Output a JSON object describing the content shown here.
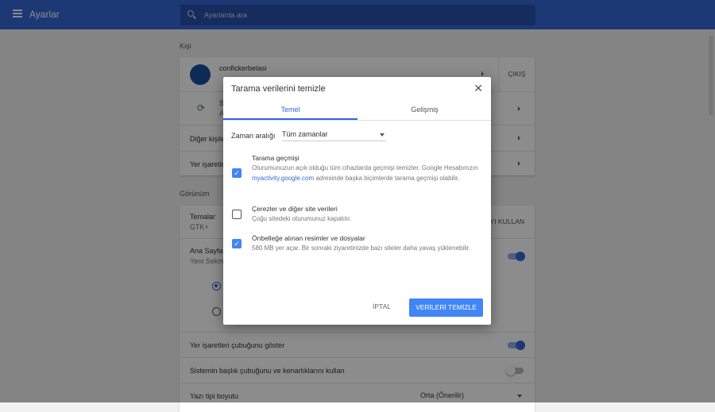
{
  "header": {
    "title": "Ayarlar",
    "search_placeholder": "Ayarlarda ara"
  },
  "people": {
    "section": "Kişi",
    "profile_name": "confickerbelasi",
    "signout": "ÇIKIŞ",
    "sync_title": "S",
    "sync_sub": "A",
    "other_people": "Diğer kişile",
    "bookmarks": "Yer işaretle"
  },
  "appearance": {
    "section": "Görünüm",
    "themes": "Temalar",
    "themes_value": "GTK+",
    "themes_button": "YI KULLAN",
    "home_title": "Ana Sayfa",
    "home_sub": "Yeni Sekme",
    "bookmarks_bar": "Yer işaretleri çubuğunu göster",
    "system_titlebar": "Sistemin başlık çubuğunu ve kenarlıklarını kullan",
    "font_size": "Yazı tipi boyutu",
    "font_size_value": "Orta (Önerilir)"
  },
  "dialog": {
    "title": "Tarama verilerini temizle",
    "tabs": [
      {
        "label": "Temel"
      },
      {
        "label": "Gelişmiş"
      }
    ],
    "range_label": "Zaman aralığı",
    "range_value": "Tüm zamanlar",
    "items": [
      {
        "title": "Tarama geçmişi",
        "desc_pre": "Oturumunuzun açık olduğu tüm cihazlarda geçmişi temizler. Google Hesabınızın ",
        "link": "myactivity.google.com",
        "desc_post": " adresinde başka biçimlerde tarama geçmişi olabilir.",
        "checked": true
      },
      {
        "title": "Çerezler ve diğer site verileri",
        "desc": "Çoğu sitedeki oturumunuz kapatılır.",
        "checked": false
      },
      {
        "title": "Önbelleğe alınan resimler ve dosyalar",
        "desc": "580 MB yer açar. Bir sonraki ziyaretinizde bazı siteler daha yavaş yüklenebilir.",
        "checked": true
      }
    ],
    "cancel": "İPTAL",
    "confirm": "VERİLERİ TEMİZLE"
  }
}
